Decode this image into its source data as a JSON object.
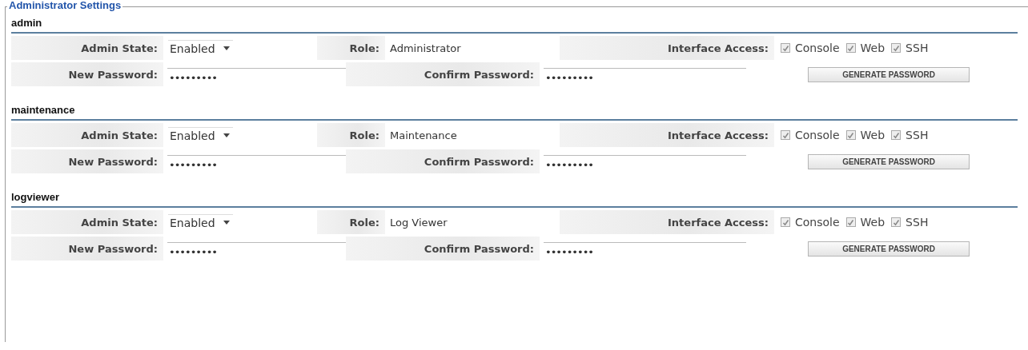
{
  "fieldset": {
    "legend": "Administrator Settings"
  },
  "users": [
    {
      "name": "admin",
      "admin_state_label": "Admin State:",
      "admin_state": "Enabled",
      "role_label": "Role:",
      "role": "Administrator",
      "interface_access_label": "Interface Access:",
      "interfaces": [
        {
          "label": "Console",
          "checked": true
        },
        {
          "label": "Web",
          "checked": true
        },
        {
          "label": "SSH",
          "checked": true
        }
      ],
      "new_password_label": "New Password:",
      "new_password": "•••••••••",
      "confirm_password_label": "Confirm Password:",
      "confirm_password": "•••••••••",
      "button": "GENERATE PASSWORD"
    },
    {
      "name": "maintenance",
      "admin_state_label": "Admin State:",
      "admin_state": "Enabled",
      "role_label": "Role:",
      "role": "Maintenance",
      "interface_access_label": "Interface Access:",
      "interfaces": [
        {
          "label": "Console",
          "checked": true
        },
        {
          "label": "Web",
          "checked": true
        },
        {
          "label": "SSH",
          "checked": true
        }
      ],
      "new_password_label": "New Password:",
      "new_password": "•••••••••",
      "confirm_password_label": "Confirm Password:",
      "confirm_password": "•••••••••",
      "button": "GENERATE PASSWORD"
    },
    {
      "name": "logviewer",
      "admin_state_label": "Admin State:",
      "admin_state": "Enabled",
      "role_label": "Role:",
      "role": "Log Viewer",
      "interface_access_label": "Interface Access:",
      "interfaces": [
        {
          "label": "Console",
          "checked": true
        },
        {
          "label": "Web",
          "checked": true
        },
        {
          "label": "SSH",
          "checked": true
        }
      ],
      "new_password_label": "New Password:",
      "new_password": "•••••••••",
      "confirm_password_label": "Confirm Password:",
      "confirm_password": "•••••••••",
      "button": "GENERATE PASSWORD"
    }
  ]
}
